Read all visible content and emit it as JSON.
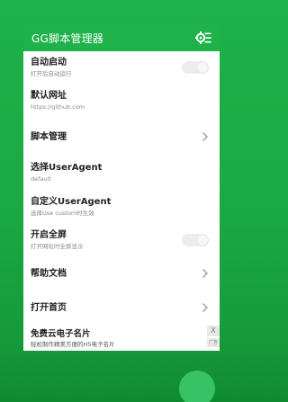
{
  "app": {
    "title": "GG脚本管理器",
    "settings_icon": "settings-menu-icon"
  },
  "settings": [
    {
      "title": "自动启动",
      "subtitle": "打开后自动运行",
      "control": "toggle",
      "enabled": false
    },
    {
      "title": "默认网址",
      "subtitle": "https://github.com",
      "control": "none"
    },
    {
      "title": "脚本管理",
      "subtitle": "",
      "control": "chevron"
    },
    {
      "title": "选择UserAgent",
      "subtitle": "default",
      "control": "none"
    },
    {
      "title": "自定义UserAgent",
      "subtitle": "选择Use custom时生效",
      "control": "none"
    },
    {
      "title": "开启全屏",
      "subtitle": "打开网址时全屏显示",
      "control": "toggle",
      "enabled": false
    },
    {
      "title": "帮助文档",
      "subtitle": "",
      "control": "chevron"
    },
    {
      "title": "打开首页",
      "subtitle": "",
      "control": "chevron"
    }
  ],
  "ad": {
    "title": "免费云电子名片",
    "subtitle": "轻松制作精美方便的H5电子名片",
    "close_label": "X",
    "badge_label": "广告"
  },
  "colors": {
    "primary": "#1fb24a",
    "fab": "#36c265"
  }
}
